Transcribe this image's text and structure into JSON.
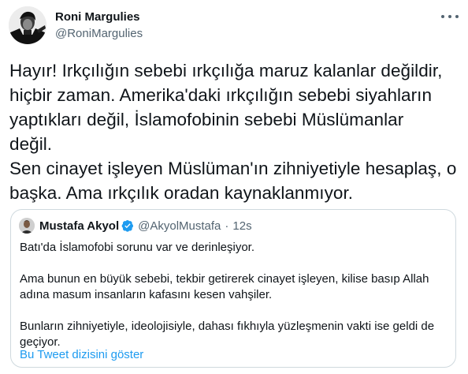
{
  "author": {
    "name": "Roni Margulies",
    "handle": "@RoniMargulies"
  },
  "tweet": {
    "lines": [
      "Hayır! Irkçılığın sebebi ırkçılığa maruz kalanlar değildir,",
      "hiçbir zaman. Amerika'daki ırkçılığın sebebi siyahların",
      "yaptıkları değil, İslamofobinin sebebi Müslümanlar",
      "değil.",
      "Sen cinayet işleyen Müslüman'ın zihniyetiyle hesaplaş, o",
      "başka. Ama ırkçılık oradan kaynaklanmıyor."
    ]
  },
  "quoted": {
    "name": "Mustafa Akyol",
    "handle": "@AkyolMustafa",
    "separator": "·",
    "time": "12s",
    "paragraph1": "Batı'da İslamofobi sorunu var ve derinleşiyor.",
    "paragraph2_lines": [
      "Ama bunun en büyük sebebi, tekbir getirerek cinayet işleyen, kilise basıp Allah",
      "adına masum insanların kafasını kesen vahşiler."
    ],
    "paragraph3_lines": [
      "Bunların zihniyetiyle, ideolojisiyle, dahası fıkhıyla yüzleşmenin vakti ise geldi de",
      "geçiyor."
    ],
    "thread_link": "Bu Tweet dizisini göster"
  },
  "colors": {
    "text": "#0f1419",
    "secondary": "#536471",
    "link": "#1d9bf0",
    "border": "#cfd9de"
  },
  "icons": {
    "more": "more-icon",
    "verified": "verified-badge-icon"
  }
}
